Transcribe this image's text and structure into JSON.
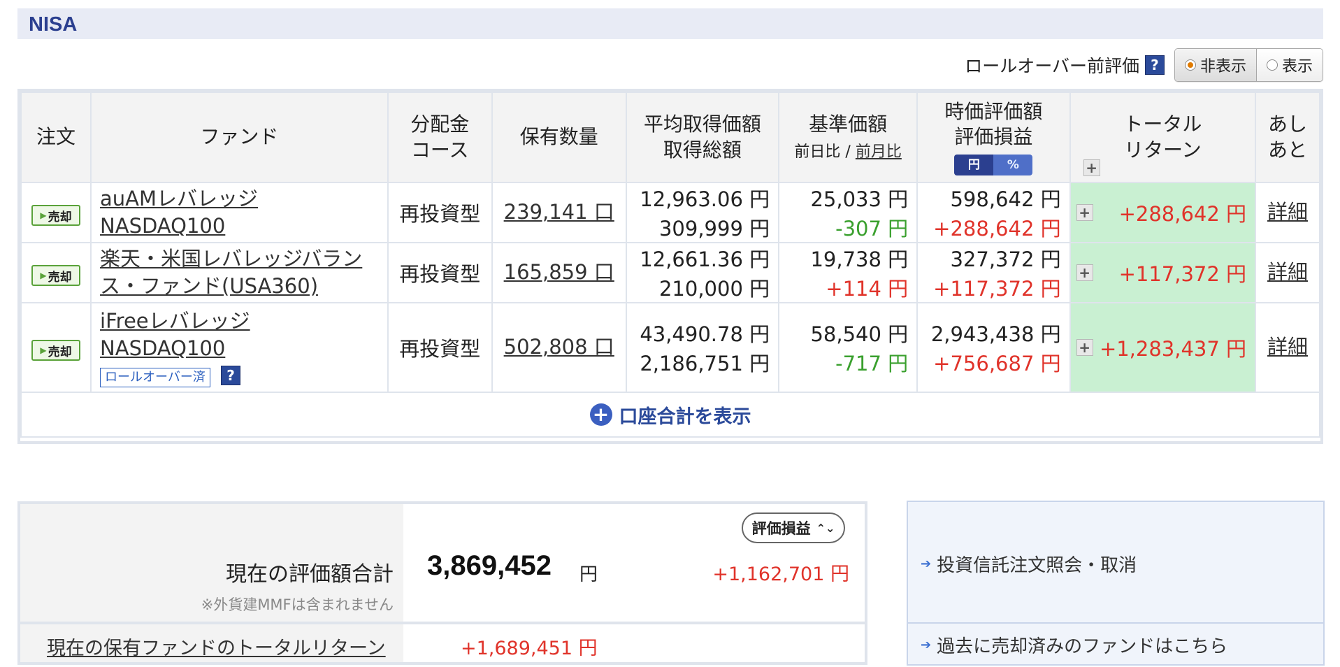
{
  "section": {
    "title": "NISA"
  },
  "rollover": {
    "label": "ロールオーバー前評価",
    "help": "?",
    "hide": "非表示",
    "show": "表示"
  },
  "table": {
    "headers": {
      "order": "注文",
      "fund": "ファンド",
      "dist1": "分配金",
      "dist2": "コース",
      "qty": "保有数量",
      "avg1": "平均取得価額",
      "avg2": "取得総額",
      "base1": "基準価額",
      "base_prev_day": "前日比",
      "base_sep": " / ",
      "base_prev_month": "前月比",
      "mv1": "時価評価額",
      "mv2": "評価損益",
      "unit_yen": "円",
      "unit_pct": "%",
      "tr1": "トータル",
      "tr2": "リターン",
      "plus": "+",
      "hist1": "あし",
      "hist2": "あと"
    },
    "sell_label": "売却",
    "detail_label": "詳細",
    "rows": [
      {
        "fund_line1": "auAMレバレッジ",
        "fund_line2": "NASDAQ100",
        "course": "再投資型",
        "qty": "239,141 口",
        "avg_price": "12,963.06 円",
        "cost": "309,999 円",
        "base_price": "25,033 円",
        "change": "-307 円",
        "market_value": "598,642 円",
        "gain": "+288,642 円",
        "total_return": "+288,642 円"
      },
      {
        "fund_line1": "楽天・米国レバレッジバラン",
        "fund_line2": "ス・ファンド(USA360)",
        "course": "再投資型",
        "qty": "165,859 口",
        "avg_price": "12,661.36 円",
        "cost": "210,000 円",
        "base_price": "19,738 円",
        "change": "+114 円",
        "market_value": "327,372 円",
        "gain": "+117,372 円",
        "total_return": "+117,372 円"
      },
      {
        "fund_line1": "iFreeレバレッジ",
        "fund_line2": "NASDAQ100",
        "rollover_tag": "ロールオーバー済",
        "course": "再投資型",
        "qty": "502,808 口",
        "avg_price": "43,490.78 円",
        "cost": "2,186,751 円",
        "base_price": "58,540 円",
        "change": "-717 円",
        "market_value": "2,943,438 円",
        "gain": "+756,687 円",
        "total_return": "+1,283,437 円"
      }
    ],
    "show_total": "口座合計を表示"
  },
  "summary": {
    "eval_label": "現在の評価額合計",
    "eval_note": "※外貨建MMFは含まれません",
    "select_label": "評価損益",
    "eval_amount": "3,869,452",
    "eval_yen": "円",
    "eval_gain": "+1,162,701 円",
    "tr_label": "現在の保有ファンドのトータルリターン",
    "tr_value": "+1,689,451 円"
  },
  "links": {
    "order_inquiry": "投資信託注文照会・取消",
    "past_sold": "過去に売却済みのファンドはこちら"
  },
  "colors": {
    "positive": "#e0332a",
    "negative": "#3aa02e",
    "total_return_bg": "#c9f0d2",
    "brand": "#2b3f8f"
  }
}
